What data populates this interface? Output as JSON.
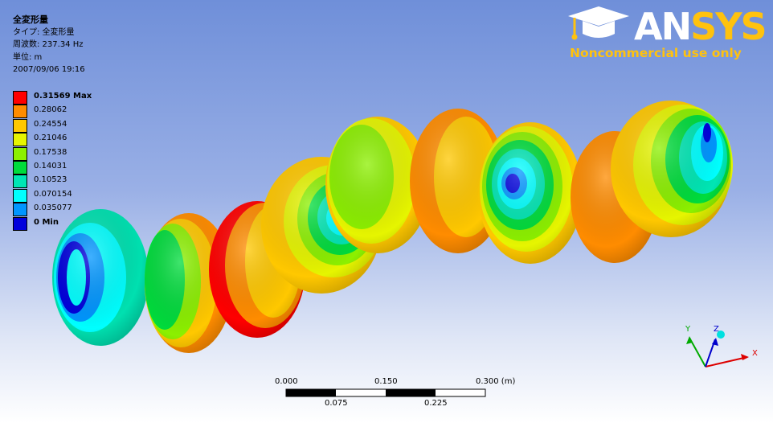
{
  "info": {
    "title": "全変形量",
    "type_line": "タイプ: 全変形量",
    "frequency_line": "周波数: 237.34 Hz",
    "unit_line": "単位: m",
    "datetime": "2007/09/06 19:16"
  },
  "legend": [
    {
      "label": "0.31569 Max",
      "color": "#ff0000",
      "bold": true
    },
    {
      "label": "0.28062",
      "color": "#ff8c00",
      "bold": false
    },
    {
      "label": "0.24554",
      "color": "#ffc800",
      "bold": false
    },
    {
      "label": "0.21046",
      "color": "#e6f500",
      "bold": false
    },
    {
      "label": "0.17538",
      "color": "#8cf000",
      "bold": false
    },
    {
      "label": "0.14031",
      "color": "#00dc3c",
      "bold": false
    },
    {
      "label": "0.10523",
      "color": "#00e6b4",
      "bold": false
    },
    {
      "label": "0.070154",
      "color": "#00ffff",
      "bold": false
    },
    {
      "label": "0.035077",
      "color": "#0096ff",
      "bold": false
    },
    {
      "label": "0 Min",
      "color": "#0000dc",
      "bold": true
    }
  ],
  "logo": {
    "word_main": "AN",
    "word_accent": "SYS",
    "tagline": "Noncommercial use only"
  },
  "triad": {
    "x": "X",
    "y": "Y",
    "z": "Z"
  },
  "scale": {
    "top_labels": [
      "0.000",
      "0.150",
      "0.300 (m)"
    ],
    "bottom_labels": [
      "0.075",
      "0.225"
    ]
  }
}
